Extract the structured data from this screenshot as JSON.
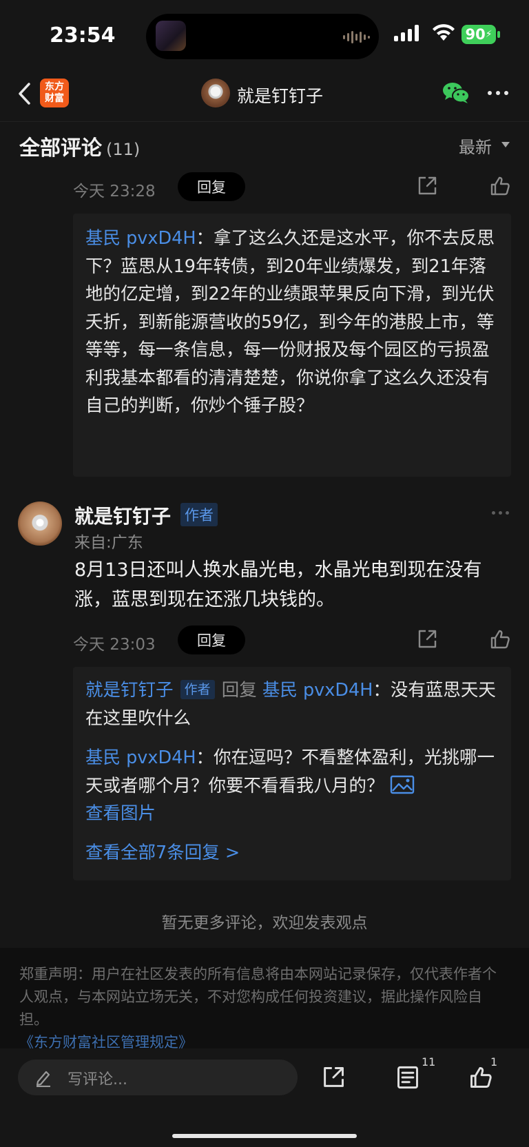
{
  "status_bar": {
    "time": "23:54",
    "battery": "90"
  },
  "nav": {
    "logo_line1": "东方",
    "logo_line2": "财富",
    "title": "就是钉钉子"
  },
  "section": {
    "title": "全部评论",
    "count": "(11)",
    "sort": "最新"
  },
  "reply1": {
    "time": "今天 23:28",
    "reply_button": "回复",
    "quote_user": "基民 pvxD4H",
    "quote_sep": "：",
    "quote_text": "拿了这么久还是这水平，你不去反思下？蓝思从19年转债，到20年业绩爆发，到21年落地的亿定增，到22年的业绩跟苹果反向下滑，到光伏夭折，到新能源营收的59亿，到今年的港股上市，等等等，每一条信息，每一份财报及每个园区的亏损盈利我基本都看的清清楚楚，你说你拿了这么久还没有自己的判断，你炒个锤子股？"
  },
  "comment": {
    "name": "就是钉钉子",
    "author_tag": "作者",
    "location": "来自:广东",
    "body": "8月13日还叫人换水晶光电，水晶光电到现在没有涨，蓝思到现在还涨几块钱的。",
    "time": "今天 23:03",
    "reply_button": "回复",
    "sub_replies": {
      "r1_user": "就是钉钉子",
      "r1_tag": "作者",
      "r1_reply_word": "回复",
      "r1_target": "基民 pvxD4H",
      "r1_sep": "：",
      "r1_text": "没有蓝思天天在这里吹什么",
      "r2_user": "基民 pvxD4H",
      "r2_sep": "：",
      "r2_text": "你在逗吗？不看整体盈利，光挑哪一天或者哪个月？你要不看看我八月的？",
      "r2_image_link": "查看图片",
      "view_all": "查看全部7条回复 >"
    }
  },
  "no_more": "暂无更多评论，欢迎发表观点",
  "disclaimer": {
    "text": "郑重声明：用户在社区发表的所有信息将由本网站记录保存，仅代表作者个人观点，与本网站立场无关，不对您构成任何投资建议，据此操作风险自担。",
    "link": "《东方财富社区管理规定》"
  },
  "bottom_bar": {
    "placeholder": "写评论...",
    "comment_count": "11",
    "like_count": "1"
  },
  "colors": {
    "accent_blue": "#4a8ee6",
    "logo_orange": "#f05a1a",
    "battery_green": "#3fcf5a",
    "wechat_green": "#3cc85c"
  },
  "icons": [
    "back-icon",
    "share-icon",
    "like-icon",
    "wechat-icon",
    "more-icon",
    "image-icon",
    "pencil-icon",
    "list-icon"
  ]
}
